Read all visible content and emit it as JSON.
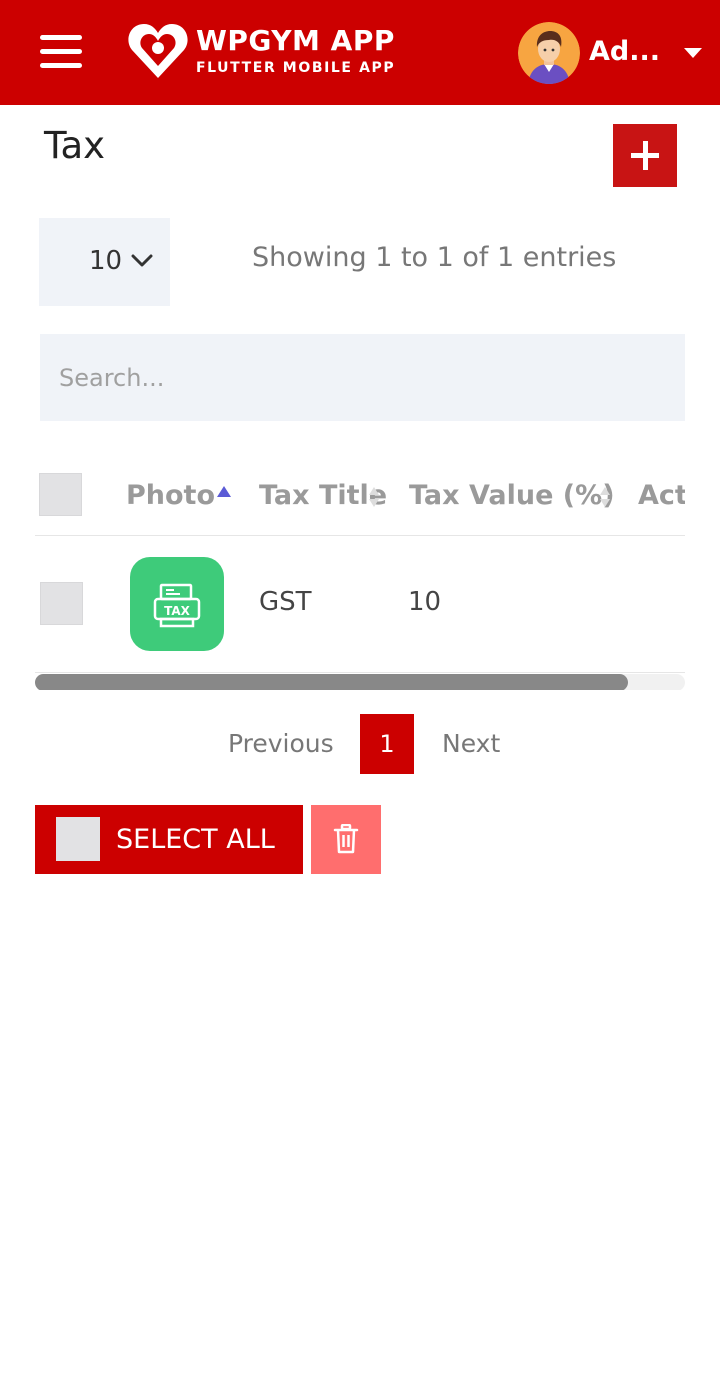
{
  "header": {
    "app_title": "WPGYM APP",
    "app_subtitle": "FLUTTER MOBILE APP",
    "user_name": "Ad...",
    "colors": {
      "brand": "#cc0000"
    }
  },
  "page": {
    "title": "Tax"
  },
  "table_controls": {
    "page_length": "10",
    "info": "Showing 1 to 1 of 1 entries",
    "search_placeholder": "Search..."
  },
  "table": {
    "columns": [
      "Photo",
      "Tax Title",
      "Tax Value (%)",
      "Act"
    ],
    "rows": [
      {
        "photo_icon": "tax-receipt-icon",
        "title": "GST",
        "value": "10"
      }
    ]
  },
  "pagination": {
    "previous": "Previous",
    "current": "1",
    "next": "Next"
  },
  "bulk": {
    "select_all": "SELECT ALL"
  }
}
